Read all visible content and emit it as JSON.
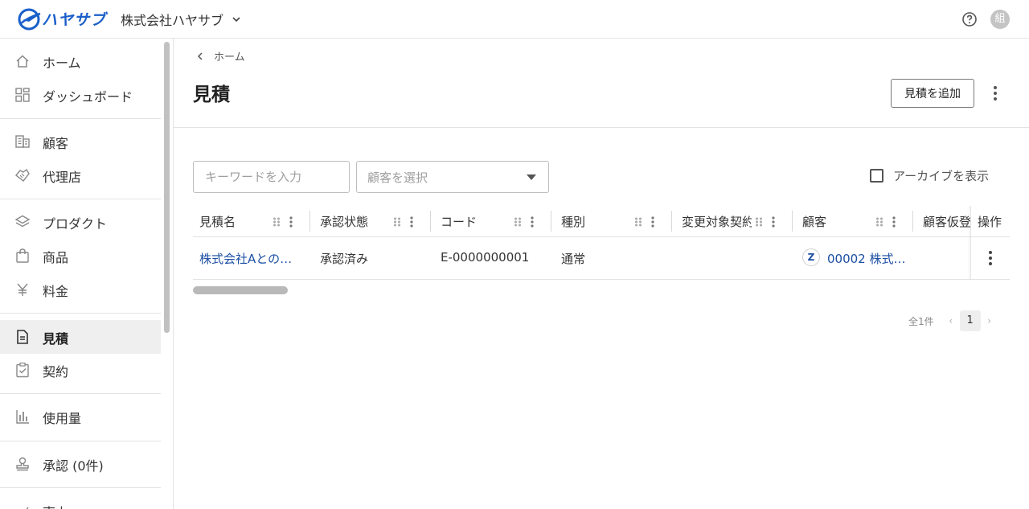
{
  "header": {
    "logo_text": "ハヤサブ",
    "company_name": "株式会社ハヤサブ",
    "avatar_initial": "組"
  },
  "sidebar": {
    "items": [
      {
        "label": "ホーム",
        "icon": "home-icon"
      },
      {
        "label": "ダッシュボード",
        "icon": "dashboard-icon"
      },
      {
        "label": "顧客",
        "icon": "building-icon"
      },
      {
        "label": "代理店",
        "icon": "handshake-icon"
      },
      {
        "label": "プロダクト",
        "icon": "layers-icon"
      },
      {
        "label": "商品",
        "icon": "shopping-bag-icon"
      },
      {
        "label": "料金",
        "icon": "yen-icon"
      },
      {
        "label": "見積",
        "icon": "document-icon",
        "active": true
      },
      {
        "label": "契約",
        "icon": "clipboard-check-icon"
      },
      {
        "label": "使用量",
        "icon": "bar-chart-icon"
      },
      {
        "label": "承認 (0件)",
        "icon": "stamp-icon"
      },
      {
        "label": "売上",
        "icon": "sales-icon"
      }
    ]
  },
  "breadcrumb": {
    "parent": "ホーム"
  },
  "page": {
    "title": "見積",
    "add_button": "見積を追加"
  },
  "filters": {
    "keyword_placeholder": "キーワードを入力",
    "customer_placeholder": "顧客を選択",
    "archive_label": "アーカイブを表示",
    "archive_checked": false
  },
  "table": {
    "columns": [
      "見積名",
      "承認状態",
      "コード",
      "種別",
      "変更対象契約",
      "顧客",
      "顧客仮登録",
      "操作"
    ],
    "rows": [
      {
        "name": "株式会社Aとの…",
        "status": "承認済み",
        "code": "E-0000000001",
        "type": "通常",
        "target_contract": "",
        "customer_badge": "Z",
        "customer": "00002 株式…",
        "customer_provisional": ""
      }
    ]
  },
  "pagination": {
    "total": "全1件",
    "prev": "‹",
    "current_page": "1",
    "next": "›"
  },
  "colors": {
    "brand": "#1a5fc9",
    "link": "#1c4fa3",
    "active_nav_bg": "#efefef"
  }
}
